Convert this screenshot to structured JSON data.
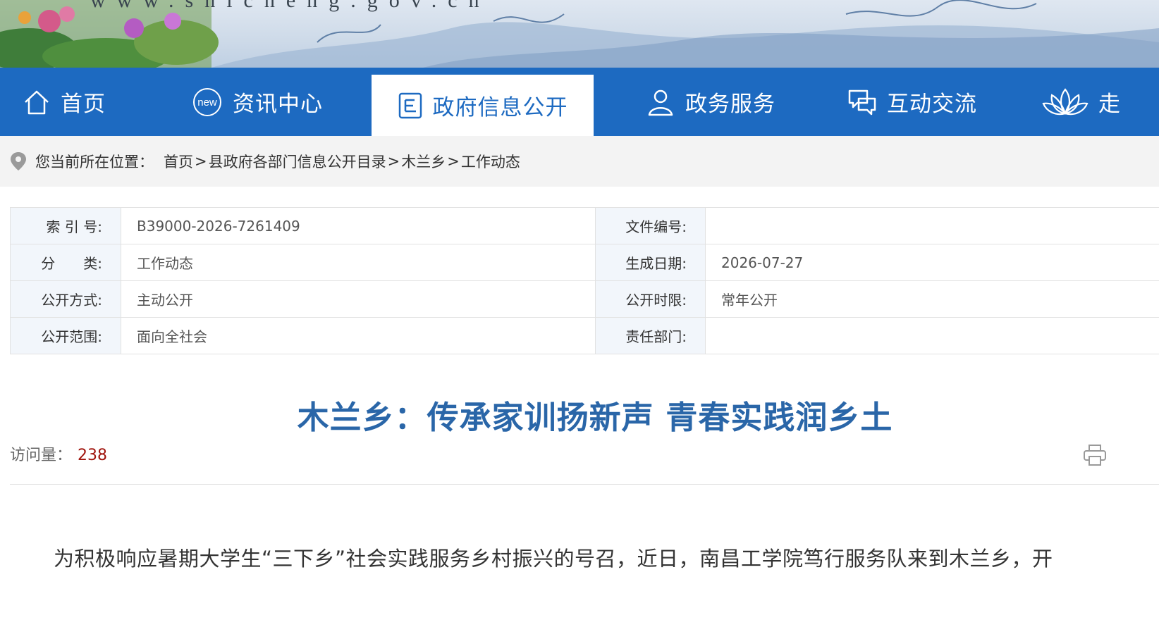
{
  "header": {
    "site_url": "www.shicheng.gov.cn"
  },
  "nav": {
    "items": [
      {
        "label": "首页",
        "icon": "home-icon"
      },
      {
        "label": "资讯中心",
        "icon": "new-badge-icon",
        "badge": "new"
      },
      {
        "label": "政府信息公开",
        "icon": "document-icon",
        "active": true
      },
      {
        "label": "政务服务",
        "icon": "user-icon"
      },
      {
        "label": "互动交流",
        "icon": "chat-icon"
      },
      {
        "label": "走",
        "icon": "lotus-icon"
      }
    ]
  },
  "breadcrumb": {
    "prefix": "您当前所在位置：",
    "items": [
      "首页",
      "县政府各部门信息公开目录",
      "木兰乡",
      "工作动态"
    ],
    "separator": ">"
  },
  "meta": {
    "rows": [
      {
        "k1": "索 引 号:",
        "v1": "B39000-2026-7261409",
        "k2": "文件编号:",
        "v2": ""
      },
      {
        "k1": "分　　类:",
        "v1": "工作动态",
        "k2": "生成日期:",
        "v2": "2026-07-27"
      },
      {
        "k1": "公开方式:",
        "v1": "主动公开",
        "k2": "公开时限:",
        "v2": "常年公开"
      },
      {
        "k1": "公开范围:",
        "v1": "面向全社会",
        "k2": "责任部门:",
        "v2": ""
      }
    ]
  },
  "article": {
    "title": "木兰乡：传承家训扬新声 青春实践润乡土",
    "views_label": "访问量：",
    "views_count": "238",
    "paragraph": "为积极响应暑期大学生“三下乡”社会实践服务乡村振兴的号召，近日，南昌工学院笃行服务队来到木兰乡，开"
  },
  "colors": {
    "nav_blue": "#1d6ac1",
    "title_blue": "#2a66a8",
    "views_red": "#a0140d"
  }
}
